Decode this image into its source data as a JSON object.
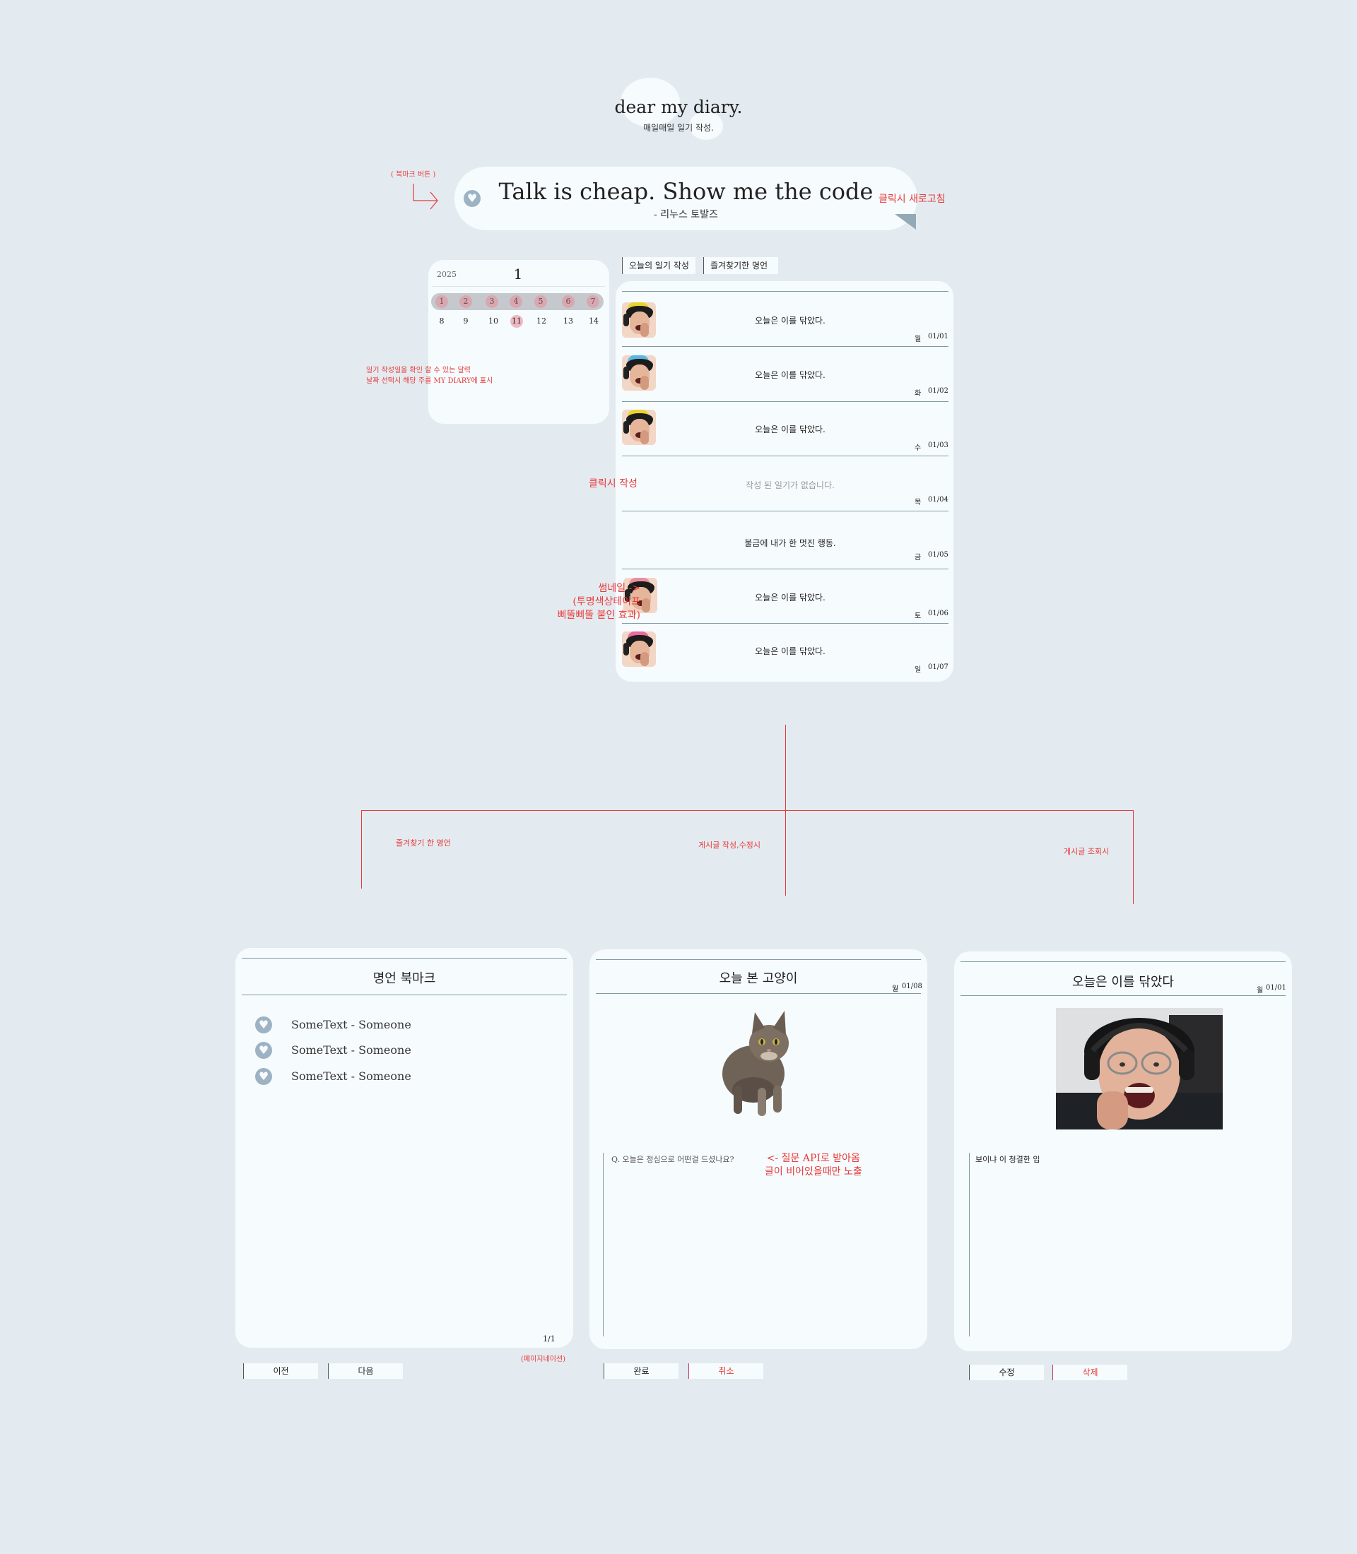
{
  "header": {
    "title": "dear my diary.",
    "subtitle": "매일매일 일기 작성."
  },
  "quote": {
    "text": "Talk is cheap. Show me the code",
    "author": "- 리누스 토발즈",
    "bookmark_annotation": "( 북마크 버튼 )",
    "refresh_annotation": "클릭시 새로고침"
  },
  "calendar": {
    "year": "2025",
    "month": "1",
    "week1": [
      "1",
      "2",
      "3",
      "4",
      "5",
      "6",
      "7"
    ],
    "week2": [
      "8",
      "9",
      "10",
      "11",
      "12",
      "13",
      "14"
    ],
    "annotation_line1": "일기 작성일을 확인 할 수 있는 달력",
    "annotation_line2": "날짜 선택시 해당 주를 MY DIARY에 표시"
  },
  "tabs": {
    "write_today": "오늘의 일기 작성",
    "favorite_quotes": "즐겨찾기한 명언"
  },
  "diary_list": {
    "entries": [
      {
        "text": "오늘은 이를 닦았다.",
        "weekday": "월",
        "date": "01/01"
      },
      {
        "text": "오늘은 이를 닦았다.",
        "weekday": "화",
        "date": "01/02"
      },
      {
        "text": "오늘은 이를 닦았다.",
        "weekday": "수",
        "date": "01/03"
      },
      {
        "text": "작성 된 일기가 없습니다.",
        "weekday": "목",
        "date": "01/04"
      },
      {
        "text": "불금에 내가 한 멋진 행동.",
        "weekday": "금",
        "date": "01/05"
      },
      {
        "text": "오늘은 이를 닦았다.",
        "weekday": "토",
        "date": "01/06"
      },
      {
        "text": "오늘은 이를 닦았다.",
        "weekday": "일",
        "date": "01/07"
      }
    ],
    "click_annotation": "클릭시 작성",
    "thumb_annotation_line1": "썸네일 ->",
    "thumb_annotation_line2": "(투명색상테이프",
    "thumb_annotation_line3": "삐뚤삐뚤 붙인 효과)"
  },
  "flow_labels": {
    "left": "즐겨찾기 한 명언",
    "center": "게시글 작성,수정시",
    "right": "게시글 조회시"
  },
  "bookmark_panel": {
    "title": "명언 북마크",
    "items": [
      "SomeText - Someone",
      "SomeText - Someone",
      "SomeText - Someone"
    ],
    "page": "1/1",
    "prev": "이전",
    "next": "다음",
    "pagination_annotation": "(페이지네이션)"
  },
  "write_panel": {
    "title": "오늘 본 고양이",
    "weekday": "월",
    "date": "01/08",
    "question": "Q. 오늘은 정심으로 어떤걸 드셨나요?",
    "api_annotation_line1": "<- 질문 API로 받아옴",
    "api_annotation_line2": "글이 비어있을때만  노출",
    "done": "완료",
    "cancel": "취소"
  },
  "view_panel": {
    "title": "오늘은 이를 닦았다",
    "weekday": "월",
    "date": "01/01",
    "content": "보이냐 이 청결한 입",
    "edit": "수정",
    "delete": "삭제"
  },
  "colors": {
    "background": "#e4ebf0",
    "card": "#f6fbfd",
    "annotation": "#e83a3a",
    "heart": "#9db2c2",
    "sunday": "#c0395f",
    "saturday": "#5a86c6"
  }
}
